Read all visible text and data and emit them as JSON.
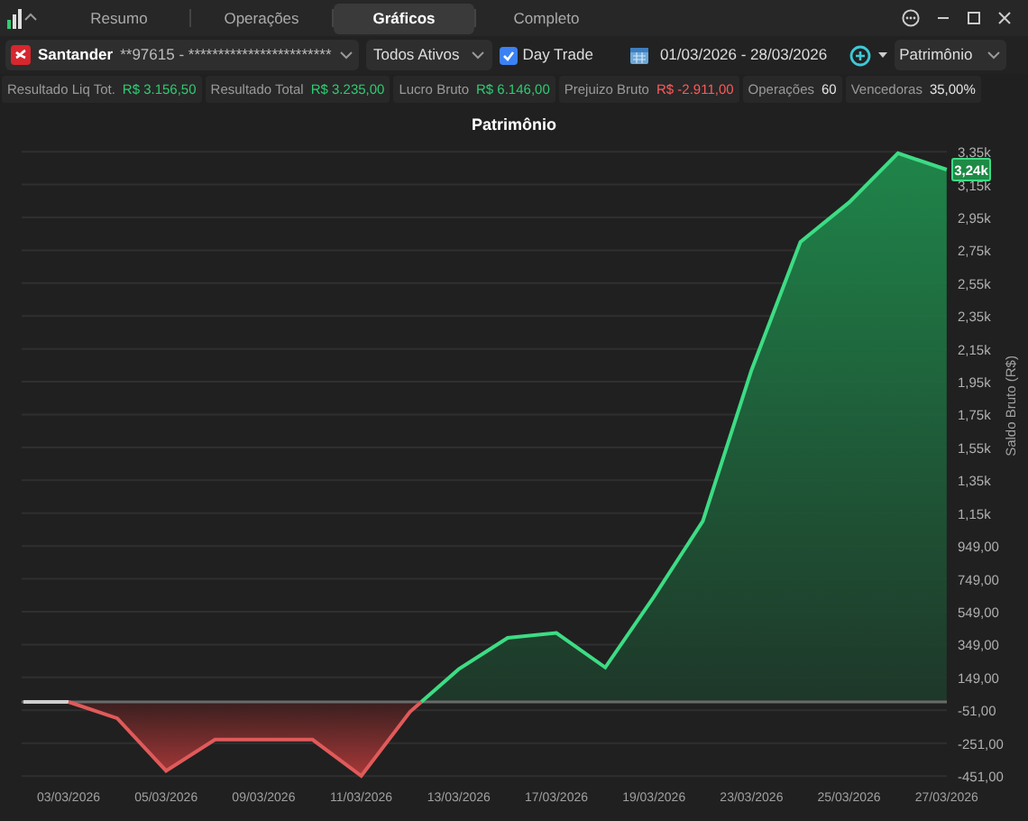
{
  "tabs": [
    {
      "label": "Resumo",
      "selected": false
    },
    {
      "label": "Operações",
      "selected": false
    },
    {
      "label": "Gráficos",
      "selected": true
    },
    {
      "label": "Completo",
      "selected": false
    }
  ],
  "account": {
    "bank": "Santander",
    "number": "**97615 - ************************"
  },
  "asset_filter": {
    "value": "Todos Ativos"
  },
  "day_trade": {
    "label": "Day Trade",
    "checked": true
  },
  "date_range": "01/03/2026 - 28/03/2026",
  "chart_type": {
    "value": "Patrimônio"
  },
  "stats": [
    {
      "label": "Resultado Liq Tot.",
      "value": "R$ 3.156,50",
      "kind": "positive"
    },
    {
      "label": "Resultado Total",
      "value": "R$ 3.235,00",
      "kind": "positive"
    },
    {
      "label": "Lucro Bruto",
      "value": "R$ 6.146,00",
      "kind": "positive"
    },
    {
      "label": "Prejuizo Bruto",
      "value": "R$ -2.911,00",
      "kind": "negative"
    },
    {
      "label": "Operações",
      "value": "60",
      "kind": "neutral"
    },
    {
      "label": "Vencedoras",
      "value": "35,00%",
      "kind": "neutral"
    }
  ],
  "chart": {
    "last_value_label": "3,24k",
    "chart_data": {
      "type": "area",
      "title": "Patrimônio",
      "ylabel": "Saldo Bruto (R$)",
      "grid": true,
      "categories": [
        "03/03/2026",
        null,
        "05/03/2026",
        null,
        "09/03/2026",
        null,
        "11/03/2026",
        null,
        "13/03/2026",
        null,
        "17/03/2026",
        null,
        "19/03/2026",
        null,
        "23/03/2026",
        null,
        "25/03/2026",
        null,
        "27/03/2026"
      ],
      "values": [
        0,
        -100,
        -420,
        -230,
        -230,
        -230,
        -450,
        -60,
        200,
        390,
        420,
        210,
        640,
        1100,
        2020,
        2800,
        3040,
        3340,
        3240
      ],
      "ylim": [
        -451,
        3349
      ],
      "yticks": [
        {
          "value": 3349,
          "label": "3,35k"
        },
        {
          "value": 3149,
          "label": "3,15k"
        },
        {
          "value": 2949,
          "label": "2,95k"
        },
        {
          "value": 2749,
          "label": "2,75k"
        },
        {
          "value": 2549,
          "label": "2,55k"
        },
        {
          "value": 2349,
          "label": "2,35k"
        },
        {
          "value": 2149,
          "label": "2,15k"
        },
        {
          "value": 1949,
          "label": "1,95k"
        },
        {
          "value": 1749,
          "label": "1,75k"
        },
        {
          "value": 1549,
          "label": "1,55k"
        },
        {
          "value": 1349,
          "label": "1,35k"
        },
        {
          "value": 1149,
          "label": "1,15k"
        },
        {
          "value": 949,
          "label": "949,00"
        },
        {
          "value": 749,
          "label": "749,00"
        },
        {
          "value": 549,
          "label": "549,00"
        },
        {
          "value": 349,
          "label": "349,00"
        },
        {
          "value": 149,
          "label": "149,00"
        },
        {
          "value": -51,
          "label": "-51,00"
        },
        {
          "value": -251,
          "label": "-251,00"
        },
        {
          "value": -451,
          "label": "-451,00"
        }
      ]
    }
  }
}
